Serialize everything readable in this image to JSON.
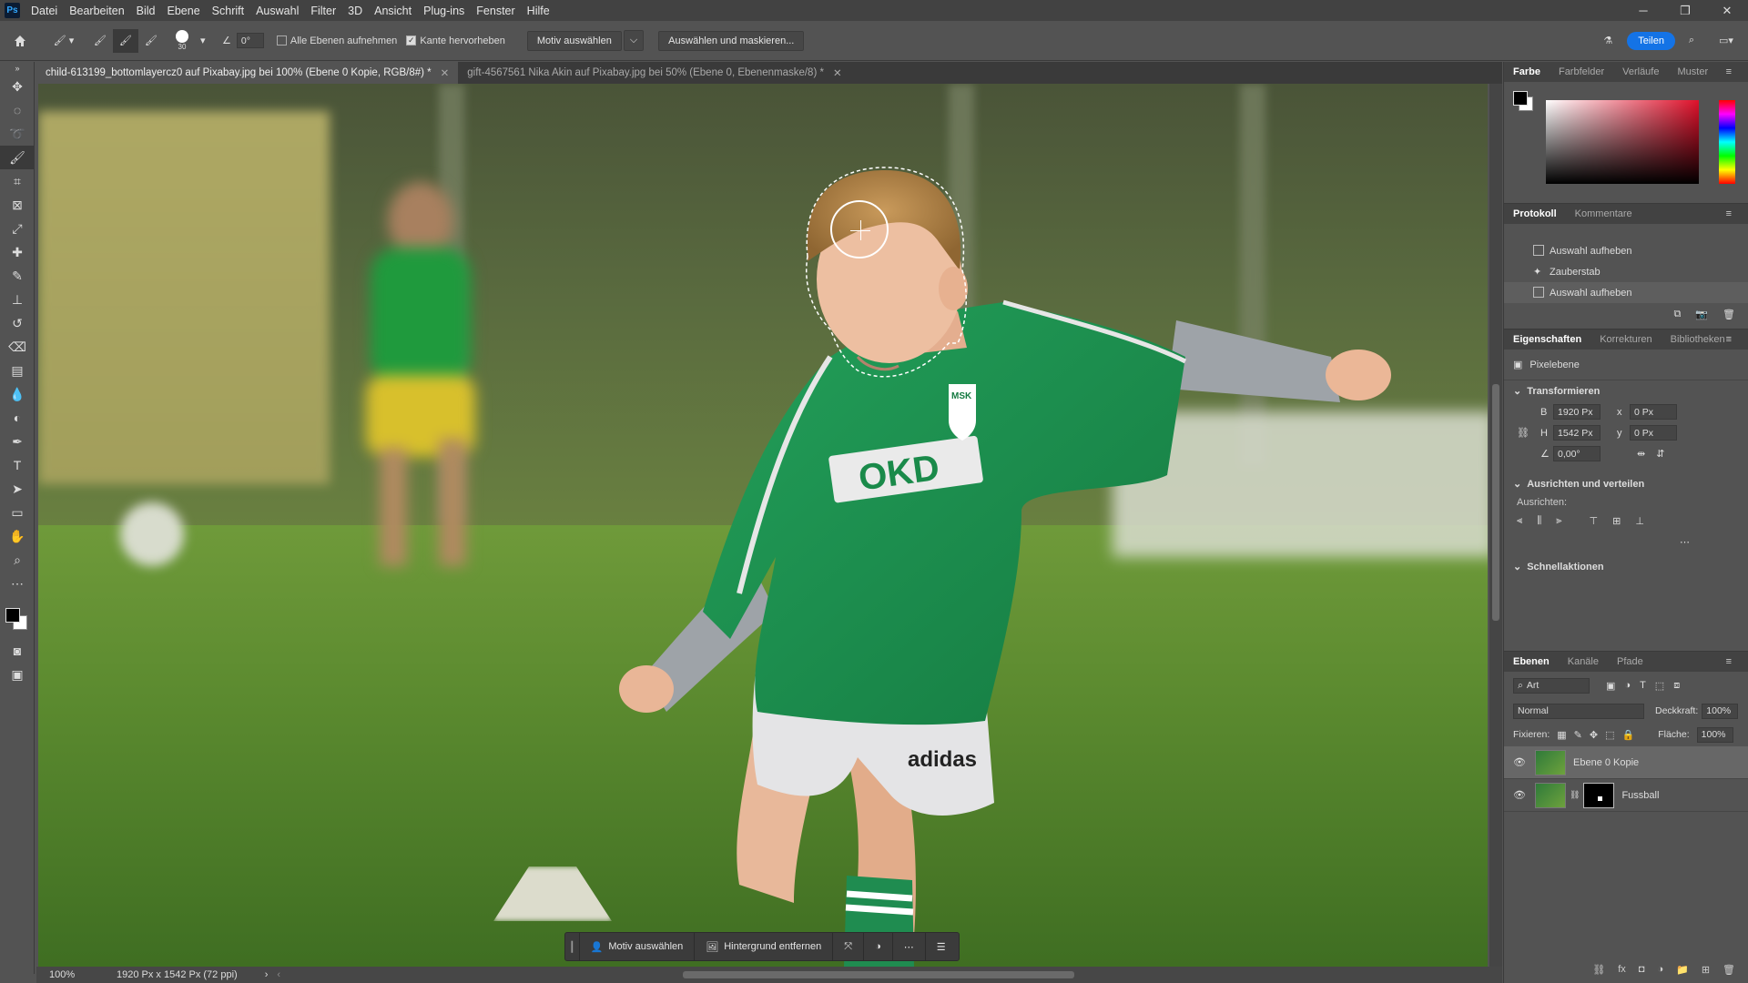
{
  "app": {
    "logo": "Ps"
  },
  "menu": [
    "Datei",
    "Bearbeiten",
    "Bild",
    "Ebene",
    "Schrift",
    "Auswahl",
    "Filter",
    "3D",
    "Ansicht",
    "Plug-ins",
    "Fenster",
    "Hilfe"
  ],
  "options": {
    "brush_size": "30",
    "angle": "0°",
    "all_layers_label": "Alle Ebenen aufnehmen",
    "edge_label": "Kante hervorheben",
    "motif_button": "Motiv auswählen",
    "mask_button": "Auswählen und maskieren...",
    "share_button": "Teilen"
  },
  "tabs": [
    {
      "label": "child-613199_bottomlayercz0 auf Pixabay.jpg bei 100% (Ebene 0 Kopie, RGB/8#) *"
    },
    {
      "label": "gift-4567561 Nika Akin auf Pixabay.jpg bei 50% (Ebene 0, Ebenenmaske/8) *"
    }
  ],
  "contextbar": {
    "motif": "Motiv auswählen",
    "remove_bg": "Hintergrund entfernen"
  },
  "status": {
    "zoom": "100%",
    "doc": "1920 Px x 1542 Px (72 ppi)"
  },
  "color_panel": {
    "tabs": [
      "Farbe",
      "Farbfelder",
      "Verläufe",
      "Muster"
    ]
  },
  "history_panel": {
    "tabs": [
      "Protokoll",
      "Kommentare"
    ],
    "items": [
      "Auswahl aufheben",
      "Zauberstab",
      "Auswahl aufheben"
    ]
  },
  "properties_panel": {
    "tabs": [
      "Eigenschaften",
      "Korrekturen",
      "Bibliotheken"
    ],
    "type": "Pixelebene",
    "transform_label": "Transformieren",
    "w_label": "B",
    "w": "1920 Px",
    "h_label": "H",
    "h": "1542 Px",
    "x_label": "x",
    "x": "0 Px",
    "y_label": "y",
    "y": "0 Px",
    "angle": "0,00°",
    "align_label": "Ausrichten und verteilen",
    "align_sub": "Ausrichten:",
    "quick_label": "Schnellaktionen"
  },
  "layers_panel": {
    "tabs": [
      "Ebenen",
      "Kanäle",
      "Pfade"
    ],
    "filter": "Art",
    "blend": "Normal",
    "opacity_label": "Deckkraft:",
    "opacity": "100%",
    "lock_label": "Fixieren:",
    "fill_label": "Fläche:",
    "fill": "100%",
    "layers": [
      {
        "name": "Ebene 0 Kopie",
        "selected": true
      },
      {
        "name": "Fussball",
        "selected": false
      }
    ]
  },
  "jersey": {
    "sponsor": "OKD",
    "crest": "MSK",
    "brand": "adidas"
  },
  "colors": {
    "jersey": "#1e8a4d",
    "accent": "#1473e6"
  }
}
